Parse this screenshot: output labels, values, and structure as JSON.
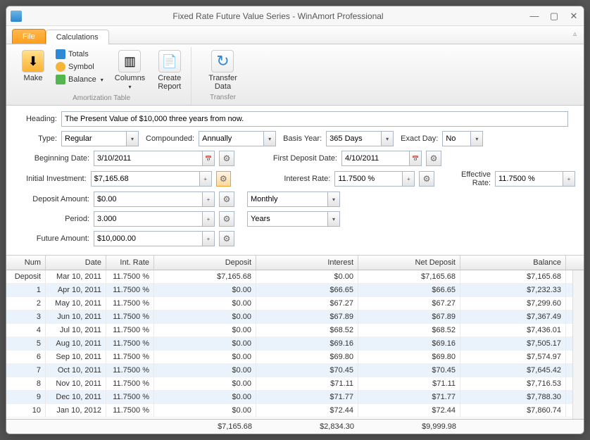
{
  "window": {
    "title": "Fixed Rate Future Value Series - WinAmort Professional"
  },
  "tabs": {
    "file": "File",
    "calc": "Calculations"
  },
  "ribbon": {
    "make": "Make",
    "totals": "Totals",
    "symbol": "Symbol",
    "balance": "Balance",
    "columns": "Columns",
    "create_report": "Create\nReport",
    "transfer": "Transfer\nData",
    "group_amort": "Amortization Table",
    "group_transfer": "Transfer"
  },
  "form": {
    "heading_label": "Heading:",
    "heading": "The Present Value of $10,000 three years from now.",
    "type_label": "Type:",
    "type": "Regular",
    "compounded_label": "Compounded:",
    "compounded": "Annually",
    "basis_label": "Basis Year:",
    "basis": "365 Days",
    "exact_label": "Exact Day:",
    "exact": "No",
    "beg_date_label": "Beginning Date:",
    "beg_date": "3/10/2011",
    "first_dep_label": "First Deposit Date:",
    "first_dep": "4/10/2011",
    "init_inv_label": "Initial Investment:",
    "init_inv": "$7,165.68",
    "int_rate_label": "Interest Rate:",
    "int_rate": "11.7500 %",
    "eff_rate_label": "Effective Rate:",
    "eff_rate": "11.7500 %",
    "dep_amt_label": "Deposit Amount:",
    "dep_amt": "$0.00",
    "dep_freq": "Monthly",
    "period_label": "Period:",
    "period": "3.000",
    "period_unit": "Years",
    "future_label": "Future Amount:",
    "future": "$10,000.00"
  },
  "grid": {
    "headers": {
      "num": "Num",
      "date": "Date",
      "rate": "Int. Rate",
      "deposit": "Deposit",
      "interest": "Interest",
      "net": "Net Deposit",
      "balance": "Balance"
    },
    "rows": [
      {
        "num": "Deposit",
        "date": "Mar 10, 2011",
        "rate": "11.7500 %",
        "deposit": "$7,165.68",
        "interest": "$0.00",
        "net": "$7,165.68",
        "balance": "$7,165.68"
      },
      {
        "num": "1",
        "date": "Apr 10, 2011",
        "rate": "11.7500 %",
        "deposit": "$0.00",
        "interest": "$66.65",
        "net": "$66.65",
        "balance": "$7,232.33"
      },
      {
        "num": "2",
        "date": "May 10, 2011",
        "rate": "11.7500 %",
        "deposit": "$0.00",
        "interest": "$67.27",
        "net": "$67.27",
        "balance": "$7,299.60"
      },
      {
        "num": "3",
        "date": "Jun 10, 2011",
        "rate": "11.7500 %",
        "deposit": "$0.00",
        "interest": "$67.89",
        "net": "$67.89",
        "balance": "$7,367.49"
      },
      {
        "num": "4",
        "date": "Jul 10, 2011",
        "rate": "11.7500 %",
        "deposit": "$0.00",
        "interest": "$68.52",
        "net": "$68.52",
        "balance": "$7,436.01"
      },
      {
        "num": "5",
        "date": "Aug 10, 2011",
        "rate": "11.7500 %",
        "deposit": "$0.00",
        "interest": "$69.16",
        "net": "$69.16",
        "balance": "$7,505.17"
      },
      {
        "num": "6",
        "date": "Sep 10, 2011",
        "rate": "11.7500 %",
        "deposit": "$0.00",
        "interest": "$69.80",
        "net": "$69.80",
        "balance": "$7,574.97"
      },
      {
        "num": "7",
        "date": "Oct 10, 2011",
        "rate": "11.7500 %",
        "deposit": "$0.00",
        "interest": "$70.45",
        "net": "$70.45",
        "balance": "$7,645.42"
      },
      {
        "num": "8",
        "date": "Nov 10, 2011",
        "rate": "11.7500 %",
        "deposit": "$0.00",
        "interest": "$71.11",
        "net": "$71.11",
        "balance": "$7,716.53"
      },
      {
        "num": "9",
        "date": "Dec 10, 2011",
        "rate": "11.7500 %",
        "deposit": "$0.00",
        "interest": "$71.77",
        "net": "$71.77",
        "balance": "$7,788.30"
      },
      {
        "num": "10",
        "date": "Jan 10, 2012",
        "rate": "11.7500 %",
        "deposit": "$0.00",
        "interest": "$72.44",
        "net": "$72.44",
        "balance": "$7,860.74"
      }
    ],
    "footer": {
      "deposit": "$7,165.68",
      "interest": "$2,834.30",
      "net": "$9,999.98",
      "balance": ""
    }
  }
}
